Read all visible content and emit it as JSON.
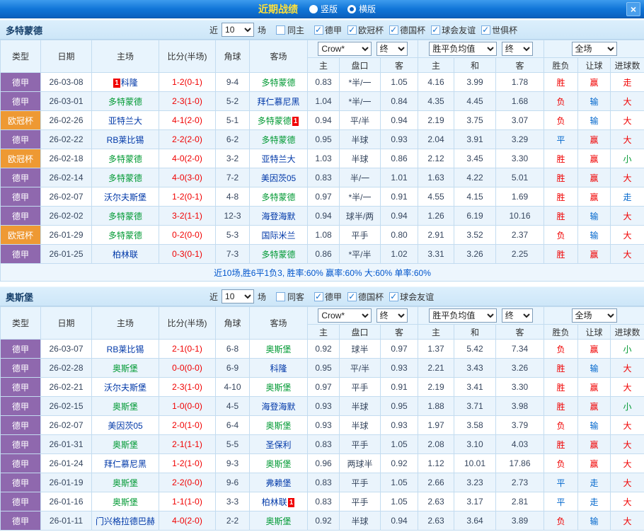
{
  "titlebar": {
    "title": "近期战绩",
    "layout_options": [
      {
        "label": "竖版",
        "selected": false
      },
      {
        "label": "横版",
        "selected": true
      }
    ],
    "close_label": "×"
  },
  "filter_labels": {
    "near": "近",
    "count": "10",
    "games": "场"
  },
  "table_header": {
    "type": "类型",
    "date": "日期",
    "home": "主场",
    "score": "比分(半场)",
    "corner": "角球",
    "away": "客场",
    "asia_select": "Crow*",
    "asia_final": "终",
    "europe_select": "胜平负均值",
    "europe_final": "终",
    "scope_select": "全场",
    "sub": [
      "主",
      "盘口",
      "客",
      "主",
      "和",
      "客",
      "胜负",
      "让球",
      "进球数"
    ]
  },
  "colors": {
    "accent_red": "#f00000",
    "accent_blue": "#0066cc",
    "accent_green": "#009933",
    "league_purple": "#8f68ae",
    "league_orange": "#ee9933"
  },
  "sections": [
    {
      "team": "多特蒙德",
      "same_label": "同主",
      "same_checked": false,
      "leagues": [
        {
          "label": "德甲",
          "checked": true
        },
        {
          "label": "欧冠杯",
          "checked": true
        },
        {
          "label": "德国杯",
          "checked": true
        },
        {
          "label": "球会友谊",
          "checked": true
        },
        {
          "label": "世俱杯",
          "checked": true
        }
      ],
      "rows": [
        {
          "league": "德甲",
          "lc": "purple",
          "date": "26-03-08",
          "home": {
            "name": "科隆",
            "badge_pre": "1"
          },
          "score": "1-2(0-1)",
          "corner": "9-4",
          "away": {
            "name": "多特蒙德",
            "focus": true
          },
          "asia": [
            "0.83",
            "*半/一",
            "1.05"
          ],
          "europe": [
            "4.16",
            "3.99",
            "1.78"
          ],
          "out": [
            {
              "t": "胜",
              "c": "red"
            },
            {
              "t": "赢",
              "c": "red"
            },
            {
              "t": "走",
              "c": "red"
            }
          ]
        },
        {
          "league": "德甲",
          "lc": "purple",
          "date": "26-03-01",
          "home": {
            "name": "多特蒙德",
            "focus": true
          },
          "score": "2-3(1-0)",
          "corner": "5-2",
          "away": {
            "name": "拜仁慕尼黑"
          },
          "asia": [
            "1.04",
            "*半/一",
            "0.84"
          ],
          "europe": [
            "4.35",
            "4.45",
            "1.68"
          ],
          "out": [
            {
              "t": "负",
              "c": "red"
            },
            {
              "t": "输",
              "c": "blue"
            },
            {
              "t": "大",
              "c": "red"
            }
          ]
        },
        {
          "league": "欧冠杯",
          "lc": "orange",
          "date": "26-02-26",
          "home": {
            "name": "亚特兰大"
          },
          "score": "4-1(2-0)",
          "corner": "5-1",
          "away": {
            "name": "多特蒙德",
            "focus": true,
            "badge_post": "1"
          },
          "asia": [
            "0.94",
            "平/半",
            "0.94"
          ],
          "europe": [
            "2.19",
            "3.75",
            "3.07"
          ],
          "out": [
            {
              "t": "负",
              "c": "red"
            },
            {
              "t": "输",
              "c": "blue"
            },
            {
              "t": "大",
              "c": "red"
            }
          ]
        },
        {
          "league": "德甲",
          "lc": "purple",
          "date": "26-02-22",
          "home": {
            "name": "RB莱比锡"
          },
          "score": "2-2(2-0)",
          "corner": "6-2",
          "away": {
            "name": "多特蒙德",
            "focus": true
          },
          "asia": [
            "0.95",
            "半球",
            "0.93"
          ],
          "europe": [
            "2.04",
            "3.91",
            "3.29"
          ],
          "out": [
            {
              "t": "平",
              "c": "blue"
            },
            {
              "t": "赢",
              "c": "red"
            },
            {
              "t": "大",
              "c": "red"
            }
          ]
        },
        {
          "league": "欧冠杯",
          "lc": "orange",
          "date": "26-02-18",
          "home": {
            "name": "多特蒙德",
            "focus": true
          },
          "score": "4-0(2-0)",
          "corner": "3-2",
          "away": {
            "name": "亚特兰大"
          },
          "asia": [
            "1.03",
            "半球",
            "0.86"
          ],
          "europe": [
            "2.12",
            "3.45",
            "3.30"
          ],
          "out": [
            {
              "t": "胜",
              "c": "red"
            },
            {
              "t": "赢",
              "c": "red"
            },
            {
              "t": "小",
              "c": "green"
            }
          ]
        },
        {
          "league": "德甲",
          "lc": "purple",
          "date": "26-02-14",
          "home": {
            "name": "多特蒙德",
            "focus": true
          },
          "score": "4-0(3-0)",
          "corner": "7-2",
          "away": {
            "name": "美因茨05"
          },
          "asia": [
            "0.83",
            "半/一",
            "1.01"
          ],
          "europe": [
            "1.63",
            "4.22",
            "5.01"
          ],
          "out": [
            {
              "t": "胜",
              "c": "red"
            },
            {
              "t": "赢",
              "c": "red"
            },
            {
              "t": "大",
              "c": "red"
            }
          ]
        },
        {
          "league": "德甲",
          "lc": "purple",
          "date": "26-02-07",
          "home": {
            "name": "沃尔夫斯堡"
          },
          "score": "1-2(0-1)",
          "corner": "4-8",
          "away": {
            "name": "多特蒙德",
            "focus": true
          },
          "asia": [
            "0.97",
            "*半/一",
            "0.91"
          ],
          "europe": [
            "4.55",
            "4.15",
            "1.69"
          ],
          "out": [
            {
              "t": "胜",
              "c": "red"
            },
            {
              "t": "赢",
              "c": "red"
            },
            {
              "t": "走",
              "c": "blue"
            }
          ]
        },
        {
          "league": "德甲",
          "lc": "purple",
          "date": "26-02-02",
          "home": {
            "name": "多特蒙德",
            "focus": true
          },
          "score": "3-2(1-1)",
          "corner": "12-3",
          "away": {
            "name": "海登海默"
          },
          "asia": [
            "0.94",
            "球半/两",
            "0.94"
          ],
          "europe": [
            "1.26",
            "6.19",
            "10.16"
          ],
          "out": [
            {
              "t": "胜",
              "c": "red"
            },
            {
              "t": "输",
              "c": "blue"
            },
            {
              "t": "大",
              "c": "red"
            }
          ]
        },
        {
          "league": "欧冠杯",
          "lc": "orange",
          "date": "26-01-29",
          "home": {
            "name": "多特蒙德",
            "focus": true
          },
          "score": "0-2(0-0)",
          "corner": "5-3",
          "away": {
            "name": "国际米兰"
          },
          "asia": [
            "1.08",
            "平手",
            "0.80"
          ],
          "europe": [
            "2.91",
            "3.52",
            "2.37"
          ],
          "out": [
            {
              "t": "负",
              "c": "red"
            },
            {
              "t": "输",
              "c": "blue"
            },
            {
              "t": "大",
              "c": "red"
            }
          ]
        },
        {
          "league": "德甲",
          "lc": "purple",
          "date": "26-01-25",
          "home": {
            "name": "柏林联"
          },
          "score": "0-3(0-1)",
          "corner": "7-3",
          "away": {
            "name": "多特蒙德",
            "focus": true
          },
          "asia": [
            "0.86",
            "*平/半",
            "1.02"
          ],
          "europe": [
            "3.31",
            "3.26",
            "2.25"
          ],
          "out": [
            {
              "t": "胜",
              "c": "red"
            },
            {
              "t": "赢",
              "c": "red"
            },
            {
              "t": "大",
              "c": "red"
            }
          ]
        }
      ],
      "summary": "近10场,胜6平1负3, 胜率:60% 赢率:60% 大:60% 单率:60%"
    },
    {
      "team": "奥斯堡",
      "same_label": "同客",
      "same_checked": false,
      "leagues": [
        {
          "label": "德甲",
          "checked": true
        },
        {
          "label": "德国杯",
          "checked": true
        },
        {
          "label": "球会友谊",
          "checked": true
        }
      ],
      "rows": [
        {
          "league": "德甲",
          "lc": "purple",
          "date": "26-03-07",
          "home": {
            "name": "RB莱比锡"
          },
          "score": "2-1(0-1)",
          "corner": "6-8",
          "away": {
            "name": "奥斯堡",
            "focus": true
          },
          "asia": [
            "0.92",
            "球半",
            "0.97"
          ],
          "europe": [
            "1.37",
            "5.42",
            "7.34"
          ],
          "out": [
            {
              "t": "负",
              "c": "red"
            },
            {
              "t": "赢",
              "c": "red"
            },
            {
              "t": "小",
              "c": "green"
            }
          ]
        },
        {
          "league": "德甲",
          "lc": "purple",
          "date": "26-02-28",
          "home": {
            "name": "奥斯堡",
            "focus": true
          },
          "score": "0-0(0-0)",
          "corner": "6-9",
          "away": {
            "name": "科隆"
          },
          "asia": [
            "0.95",
            "平/半",
            "0.93"
          ],
          "europe": [
            "2.21",
            "3.43",
            "3.26"
          ],
          "out": [
            {
              "t": "胜",
              "c": "red"
            },
            {
              "t": "输",
              "c": "blue"
            },
            {
              "t": "大",
              "c": "red"
            }
          ]
        },
        {
          "league": "德甲",
          "lc": "purple",
          "date": "26-02-21",
          "home": {
            "name": "沃尔夫斯堡"
          },
          "score": "2-3(1-0)",
          "corner": "4-10",
          "away": {
            "name": "奥斯堡",
            "focus": true
          },
          "asia": [
            "0.97",
            "平手",
            "0.91"
          ],
          "europe": [
            "2.19",
            "3.41",
            "3.30"
          ],
          "out": [
            {
              "t": "胜",
              "c": "red"
            },
            {
              "t": "赢",
              "c": "red"
            },
            {
              "t": "大",
              "c": "red"
            }
          ]
        },
        {
          "league": "德甲",
          "lc": "purple",
          "date": "26-02-15",
          "home": {
            "name": "奥斯堡",
            "focus": true
          },
          "score": "1-0(0-0)",
          "corner": "4-5",
          "away": {
            "name": "海登海默"
          },
          "asia": [
            "0.93",
            "半球",
            "0.95"
          ],
          "europe": [
            "1.88",
            "3.71",
            "3.98"
          ],
          "out": [
            {
              "t": "胜",
              "c": "red"
            },
            {
              "t": "赢",
              "c": "red"
            },
            {
              "t": "小",
              "c": "green"
            }
          ]
        },
        {
          "league": "德甲",
          "lc": "purple",
          "date": "26-02-07",
          "home": {
            "name": "美因茨05"
          },
          "score": "2-0(1-0)",
          "corner": "6-4",
          "away": {
            "name": "奥斯堡",
            "focus": true
          },
          "asia": [
            "0.93",
            "半球",
            "0.93"
          ],
          "europe": [
            "1.97",
            "3.58",
            "3.79"
          ],
          "out": [
            {
              "t": "负",
              "c": "red"
            },
            {
              "t": "输",
              "c": "blue"
            },
            {
              "t": "大",
              "c": "red"
            }
          ]
        },
        {
          "league": "德甲",
          "lc": "purple",
          "date": "26-01-31",
          "home": {
            "name": "奥斯堡",
            "focus": true
          },
          "score": "2-1(1-1)",
          "corner": "5-5",
          "away": {
            "name": "圣保利"
          },
          "asia": [
            "0.83",
            "平手",
            "1.05"
          ],
          "europe": [
            "2.08",
            "3.10",
            "4.03"
          ],
          "out": [
            {
              "t": "胜",
              "c": "red"
            },
            {
              "t": "赢",
              "c": "red"
            },
            {
              "t": "大",
              "c": "red"
            }
          ]
        },
        {
          "league": "德甲",
          "lc": "purple",
          "date": "26-01-24",
          "home": {
            "name": "拜仁慕尼黑"
          },
          "score": "1-2(1-0)",
          "corner": "9-3",
          "away": {
            "name": "奥斯堡",
            "focus": true
          },
          "asia": [
            "0.96",
            "两球半",
            "0.92"
          ],
          "europe": [
            "1.12",
            "10.01",
            "17.86"
          ],
          "out": [
            {
              "t": "负",
              "c": "red"
            },
            {
              "t": "赢",
              "c": "red"
            },
            {
              "t": "大",
              "c": "red"
            }
          ]
        },
        {
          "league": "德甲",
          "lc": "purple",
          "date": "26-01-19",
          "home": {
            "name": "奥斯堡",
            "focus": true
          },
          "score": "2-2(0-0)",
          "corner": "9-6",
          "away": {
            "name": "弗赖堡"
          },
          "asia": [
            "0.83",
            "平手",
            "1.05"
          ],
          "europe": [
            "2.66",
            "3.23",
            "2.73"
          ],
          "out": [
            {
              "t": "平",
              "c": "blue"
            },
            {
              "t": "走",
              "c": "blue"
            },
            {
              "t": "大",
              "c": "red"
            }
          ]
        },
        {
          "league": "德甲",
          "lc": "purple",
          "date": "26-01-16",
          "home": {
            "name": "奥斯堡",
            "focus": true
          },
          "score": "1-1(1-0)",
          "corner": "3-3",
          "away": {
            "name": "柏林联",
            "badge_post": "1"
          },
          "asia": [
            "0.83",
            "平手",
            "1.05"
          ],
          "europe": [
            "2.63",
            "3.17",
            "2.81"
          ],
          "out": [
            {
              "t": "平",
              "c": "blue"
            },
            {
              "t": "走",
              "c": "blue"
            },
            {
              "t": "大",
              "c": "red"
            }
          ]
        },
        {
          "league": "德甲",
          "lc": "purple",
          "date": "26-01-11",
          "home": {
            "name": "门兴格拉德巴赫"
          },
          "score": "4-0(2-0)",
          "corner": "2-2",
          "away": {
            "name": "奥斯堡",
            "focus": true
          },
          "asia": [
            "0.92",
            "半球",
            "0.94"
          ],
          "europe": [
            "2.63",
            "3.64",
            "3.89"
          ],
          "out": [
            {
              "t": "负",
              "c": "red"
            },
            {
              "t": "输",
              "c": "blue"
            },
            {
              "t": "大",
              "c": "red"
            }
          ]
        }
      ],
      "summary": null
    }
  ]
}
